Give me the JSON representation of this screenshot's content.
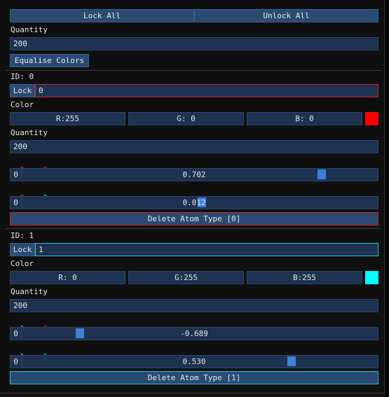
{
  "toolbar": {
    "lock_all": "Lock All",
    "unlock_all": "Unlock All"
  },
  "global": {
    "quantity_label": "Quantity",
    "quantity_value": "200",
    "equalise_label": "Equalise Colors"
  },
  "atoms": [
    {
      "id_label": "ID: 0",
      "lock_label": "Lock",
      "lock_value": "0",
      "color_label": "Color",
      "r_label": "R:255",
      "g_label": "G:  0",
      "b_label": "B:  0",
      "swatch_color": "#ff0000",
      "border_color": "#cc2222",
      "quantity_label": "Quantity",
      "quantity_value": "200",
      "rel": [
        {
          "from": "0",
          "arrow": " -> ",
          "to": "0",
          "from_color": "#ff2020",
          "to_color": "#ff2020",
          "index": "0",
          "value": "0.702",
          "fraction": 0.851
        },
        {
          "from": "0",
          "arrow": " -> ",
          "to": "1",
          "from_color": "#ff2020",
          "to_color": "#00ffff",
          "index": "0",
          "value": "0.012",
          "fraction": 0.506
        }
      ],
      "delete_label": "Delete Atom Type [0]"
    },
    {
      "id_label": "ID: 1",
      "lock_label": "Lock",
      "lock_value": "1",
      "color_label": "Color",
      "r_label": "R:  0",
      "g_label": "G:255",
      "b_label": "B:255",
      "swatch_color": "#00ffff",
      "border_color": "#22c8d8",
      "quantity_label": "Quantity",
      "quantity_value": "200",
      "rel": [
        {
          "from": "1",
          "arrow": " -> ",
          "to": "0",
          "from_color": "#00ffff",
          "to_color": "#ff2020",
          "index": "0",
          "value": "-0.689",
          "fraction": 0.156
        },
        {
          "from": "1",
          "arrow": " -> ",
          "to": "1",
          "from_color": "#00ffff",
          "to_color": "#00ffff",
          "index": "0",
          "value": "0.530",
          "fraction": 0.765
        }
      ],
      "delete_label": "Delete Atom Type [1]"
    }
  ]
}
